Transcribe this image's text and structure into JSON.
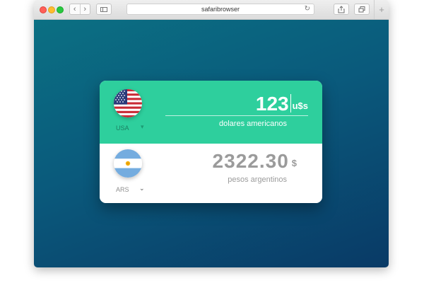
{
  "browser": {
    "url": "safaribrowser",
    "back_icon": "chevron-left-icon",
    "forward_icon": "chevron-right-icon",
    "sidebar_icon": "sidebar-icon",
    "reload_icon": "reload-icon",
    "share_icon": "share-icon",
    "tabs_icon": "tabs-icon",
    "new_tab_icon": "plus-icon"
  },
  "converter": {
    "source": {
      "code": "USA",
      "flag": "usa-flag",
      "amount": "123",
      "symbol": "u$s",
      "name": "dolares americanos"
    },
    "target": {
      "code": "ARS",
      "flag": "argentina-flag",
      "amount": "2322.30",
      "symbol": "$",
      "name": "pesos argentinos"
    }
  },
  "colors": {
    "accent": "#2ecf9d",
    "background_top": "#0b7083",
    "background_bottom": "#093a66",
    "muted_text": "#9b9b9b"
  }
}
